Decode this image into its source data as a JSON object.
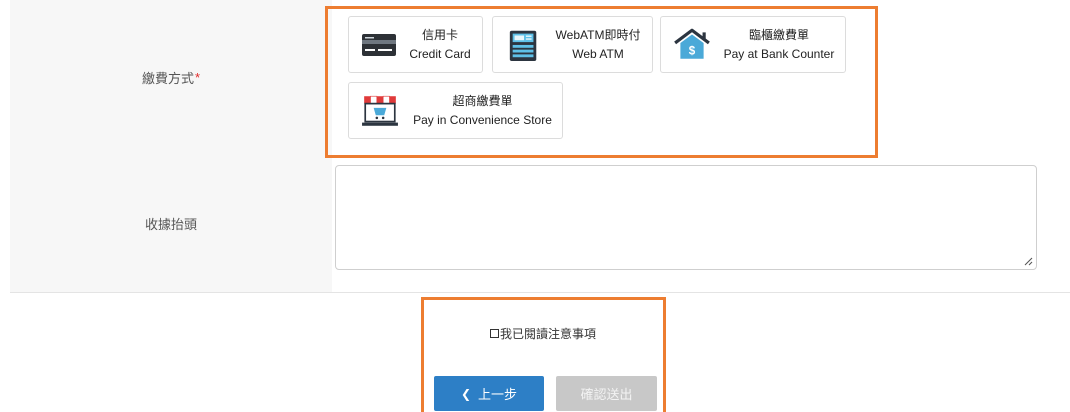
{
  "payment_row": {
    "label": "繳費方式",
    "required_mark": "*"
  },
  "payment_methods": [
    {
      "zh": "信用卡",
      "en": "Credit Card",
      "icon": "credit-card-icon"
    },
    {
      "zh": "WebATM即時付",
      "en": "Web ATM",
      "icon": "atm-icon"
    },
    {
      "zh": "臨櫃繳費單",
      "en": "Pay at Bank Counter",
      "icon": "bank-house-icon"
    },
    {
      "zh": "超商繳費單",
      "en": "Pay in Convenience Store",
      "icon": "convenience-store-icon"
    }
  ],
  "receipt_row": {
    "label": "收據抬頭",
    "value": ""
  },
  "agree": {
    "label": "我已閱讀注意事項",
    "checked": false
  },
  "buttons": {
    "prev_label": "上一步",
    "submit_label": "確認送出",
    "submit_enabled": false
  },
  "colors": {
    "highlight": "#ed7d31",
    "primary": "#2d7fc6",
    "disabled": "#c8c8c8",
    "required": "#e02a2a",
    "label_bg": "#f7f7f7"
  }
}
